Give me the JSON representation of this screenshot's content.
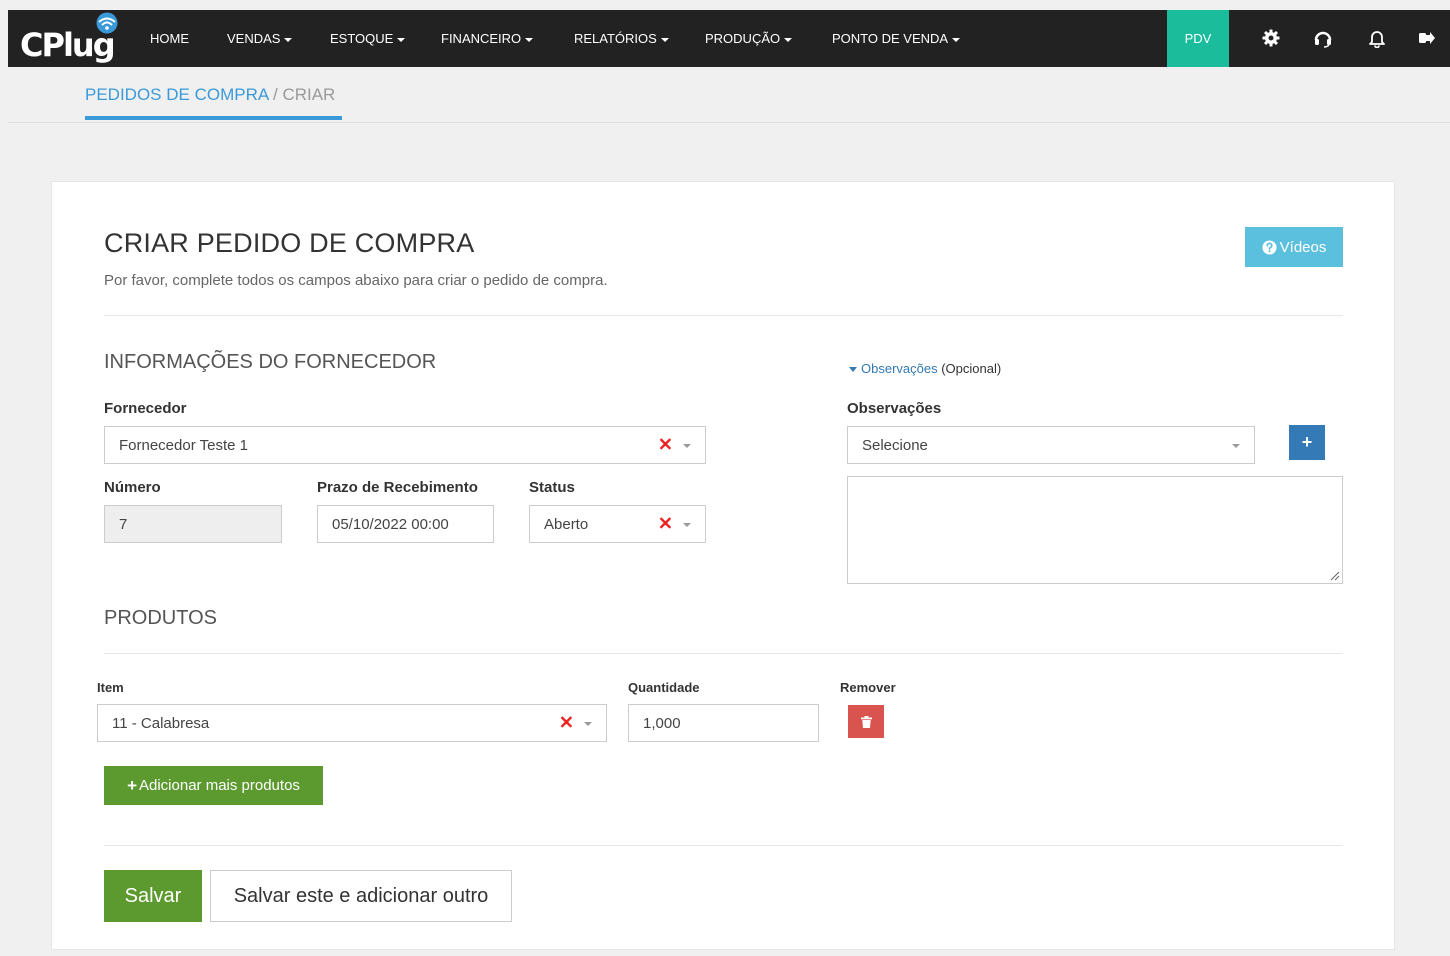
{
  "nav": {
    "logo": "CPlug",
    "items": [
      "HOME",
      "VENDAS",
      "ESTOQUE",
      "FINANCEIRO",
      "RELATÓRIOS",
      "PRODUÇÃO",
      "PONTO DE VENDA"
    ],
    "pdv": "PDV"
  },
  "breadcrumb": {
    "parent": "PEDIDOS DE COMPRA",
    "separator": " / ",
    "current": "CRIAR"
  },
  "page": {
    "title": "CRIAR PEDIDO DE COMPRA",
    "subtitle": "Por favor, complete todos os campos abaixo para criar o pedido de compra.",
    "videos_button": "Vídeos"
  },
  "supplier": {
    "section_title": "INFORMAÇÕES DO FORNECEDOR",
    "fornecedor_label": "Fornecedor",
    "fornecedor_value": "Fornecedor Teste 1",
    "numero_label": "Número",
    "numero_value": "7",
    "prazo_label": "Prazo de Recebimento",
    "prazo_value": "05/10/2022 00:00",
    "status_label": "Status",
    "status_value": "Aberto"
  },
  "observacoes": {
    "toggle_link": "Observações",
    "toggle_suffix": "(Opcional)",
    "label": "Observações",
    "select_value": "Selecione"
  },
  "produtos": {
    "section_title": "PRODUTOS",
    "item_label": "Item",
    "quantidade_label": "Quantidade",
    "remover_label": "Remover",
    "rows": [
      {
        "item": "11 - Calabresa",
        "quantidade": "1,000"
      }
    ],
    "add_button": "Adicionar mais produtos"
  },
  "actions": {
    "save": "Salvar",
    "save_and_add": "Salvar este e adicionar outro"
  },
  "colors": {
    "nav_bg": "#222222",
    "pdv_bg": "#1abc9c",
    "link_blue": "#3a9ad9",
    "videos_bg": "#5bc0de",
    "plus_bg": "#337ab7",
    "remove_bg": "#d9534f",
    "green": "#5c9a2f",
    "clear_red": "#e22222"
  }
}
